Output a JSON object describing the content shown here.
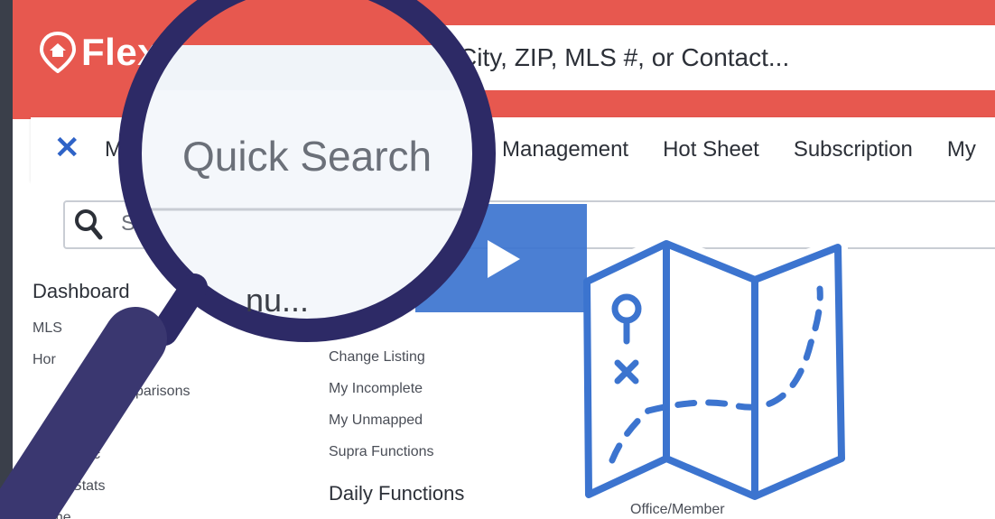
{
  "header": {
    "brand": "Flex",
    "search_placeholder": "dress, City, ZIP, MLS #, or Contact..."
  },
  "nav": {
    "close_icon": "close-icon",
    "partial_label": "M",
    "tabs": [
      "Management",
      "Hot Sheet",
      "Subscription",
      "My"
    ]
  },
  "menu_search": {
    "placeholder": "S"
  },
  "lens": {
    "title": "Quick Search",
    "menu_suffix": "nu..."
  },
  "column1": {
    "heading": "Dashboard",
    "items": [
      "MLS",
      "Hor",
      "",
      "parisons",
      "",
      "lic",
      "arket Stats",
      "Home"
    ]
  },
  "column2": {
    "items": [
      "Change Listing",
      "My Incomplete",
      "My Unmapped",
      "Supra Functions"
    ],
    "section_heading": "Daily Functions"
  },
  "column3": {
    "item": "Office/Member"
  },
  "colors": {
    "header_red": "#e7584f",
    "accent_blue": "#3c74cf",
    "lens_ring": "#2d2a66"
  },
  "icons": {
    "logo": "home-pin-icon",
    "search": "search-icon",
    "play": "play-icon",
    "map": "treasure-map-icon"
  }
}
